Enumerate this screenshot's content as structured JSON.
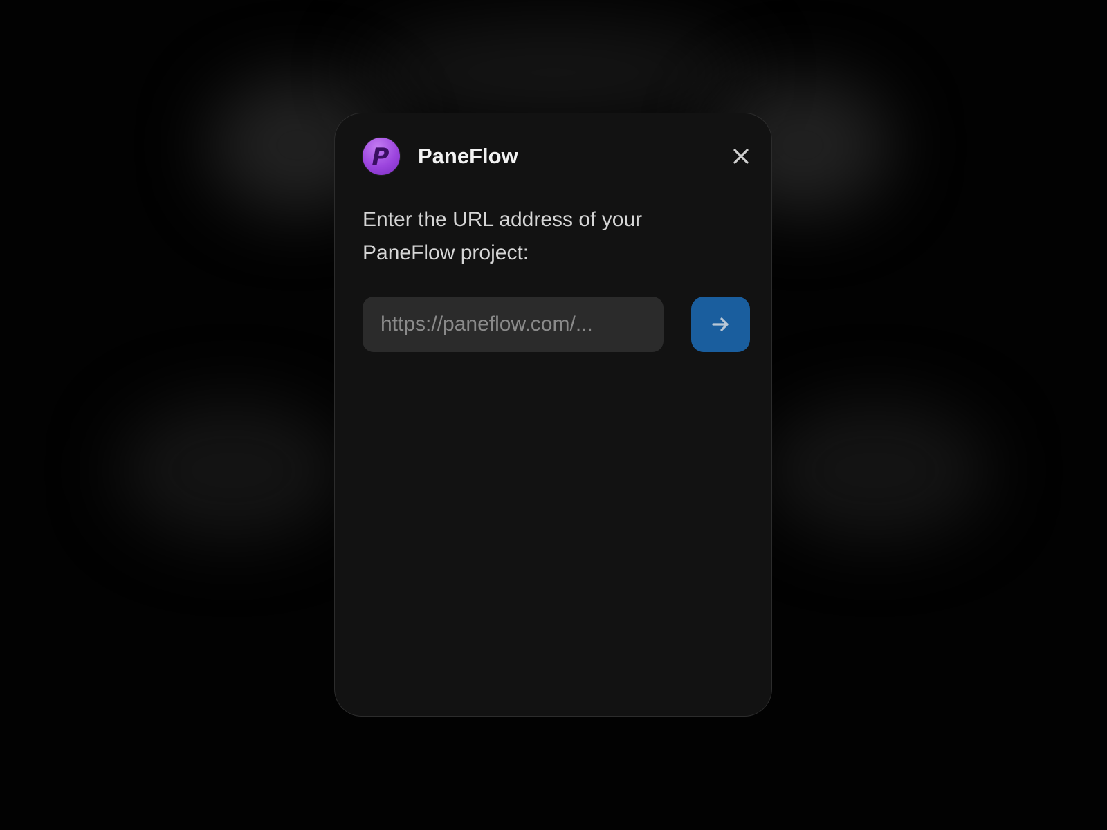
{
  "app": {
    "name": "PaneFlow",
    "logo_letter": "P",
    "logo_icon": "paneflow-logo-icon"
  },
  "dialog": {
    "prompt": "Enter the URL address of your PaneFlow project:",
    "url_input": {
      "placeholder": "https://paneflow.com/...",
      "value": ""
    },
    "submit_icon": "arrow-right-icon",
    "close_icon": "close-icon"
  },
  "colors": {
    "background": "#000000",
    "dialog_background": "#121212",
    "input_background": "#2b2b2b",
    "accent_button": "#1a5e9e",
    "logo_purple": "#9c45de"
  }
}
